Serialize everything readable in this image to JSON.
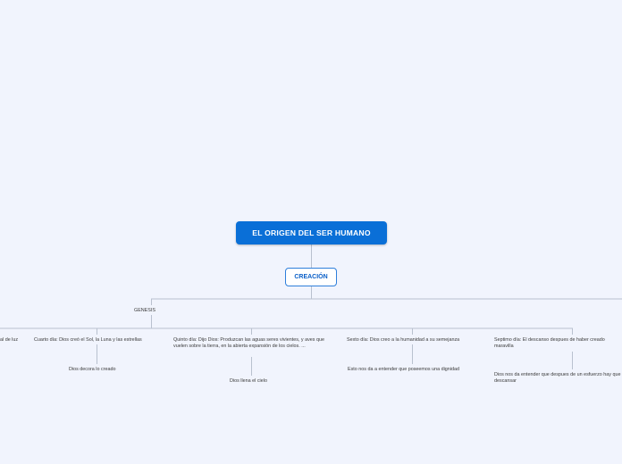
{
  "colors": {
    "background": "#f1f4fd",
    "root_fill": "#0a6fd7",
    "connector": "#b9c1cf"
  },
  "root": {
    "label": "EL ORIGEN DEL SER HUMANO"
  },
  "main_topic": {
    "label": "CREACIÓN"
  },
  "branch": {
    "label": "GENESIS"
  },
  "days": [
    {
      "text": "al de luz"
    },
    {
      "text": "Cuarto día: Dios creó el Sol, la Luna y las estrellas",
      "sub": "Dios decora lo creado"
    },
    {
      "text": "Quinto día: Dijo Dios: Produzcan las aguas seres vivientes, y aves que vuelen sobre la tierra, en la abierta expansión de los cielos. ...",
      "sub": "Dios llena el cielo"
    },
    {
      "text": "Sexto día: Dios creo a la humanidad a su semejanza",
      "sub": "Esto nos da a entender que poseemos una dignidad"
    },
    {
      "text": "Septimo día: El descanso despues de haber creado maravilla",
      "sub": "Dios nos da entender que despues de un esfuerzo hay que descansar"
    }
  ]
}
